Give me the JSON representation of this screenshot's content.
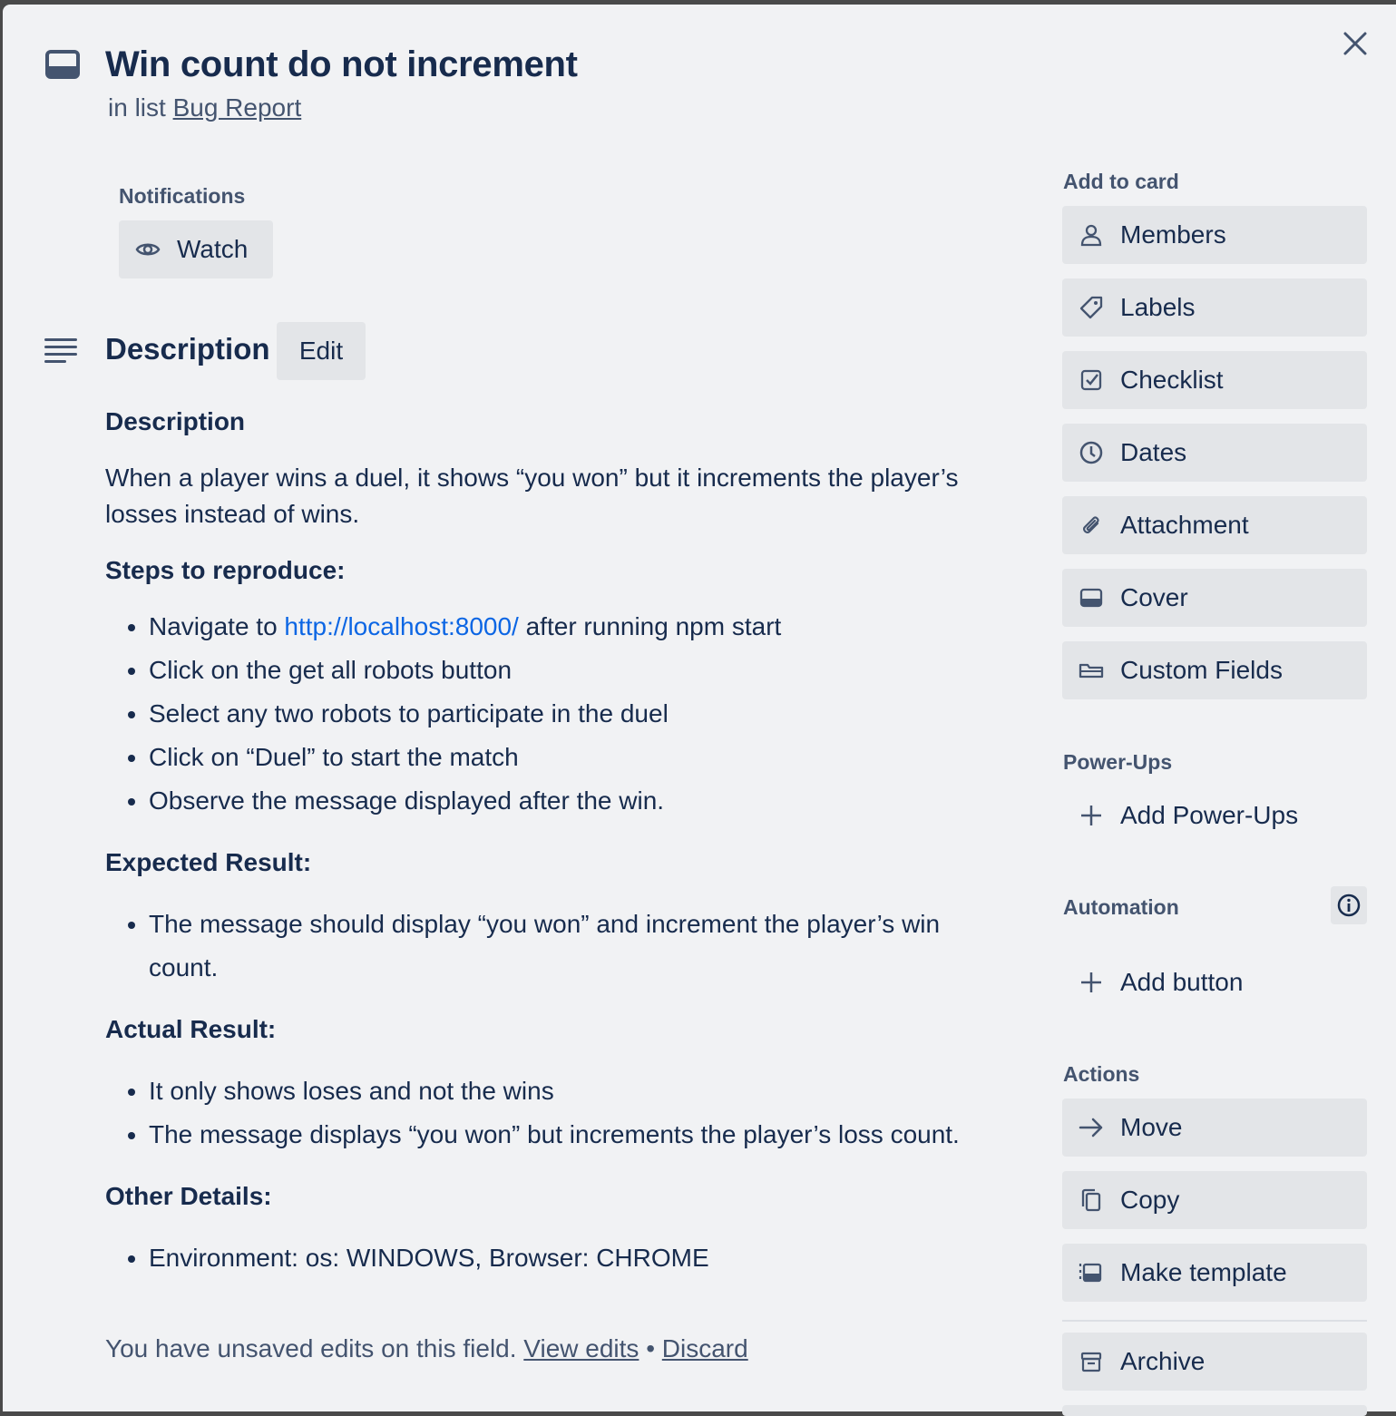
{
  "card": {
    "title": "Win count do not increment",
    "list_prefix": "in list",
    "list_name": "Bug Report"
  },
  "notifications": {
    "label": "Notifications",
    "watch_label": "Watch"
  },
  "description": {
    "heading": "Description",
    "edit_label": "Edit",
    "h_description": "Description",
    "intro": "When a player wins a duel, it shows “you won” but it increments the player’s losses instead of wins.",
    "h_steps": "Steps to reproduce:",
    "step1_pre": "Navigate to",
    "step1_link": "http://localhost:8000/",
    "step1_post": "after running npm start",
    "step2": "Click on the get all robots button",
    "step3": "Select any two robots to participate in the duel",
    "step4": "Click on “Duel” to start the match",
    "step5": "Observe the message displayed after the win.",
    "h_expected": "Expected Result:",
    "expected1": "The message should display “you won” and increment the player’s win count.",
    "h_actual": "Actual Result:",
    "actual1": "It only shows loses and not the wins",
    "actual2": "The message displays “you won” but increments the player’s loss count.",
    "h_other": "Other Details:",
    "other1": "Environment: os: WINDOWS, Browser: CHROME",
    "unsaved_text": "You have unsaved edits on this field.",
    "view_edits": "View edits",
    "separator": "•",
    "discard": "Discard"
  },
  "sidebar": {
    "add_to_card_label": "Add to card",
    "members": "Members",
    "labels": "Labels",
    "checklist": "Checklist",
    "dates": "Dates",
    "attachment": "Attachment",
    "cover": "Cover",
    "custom_fields": "Custom Fields",
    "powerups_label": "Power-Ups",
    "add_powerups": "Add Power-Ups",
    "automation_label": "Automation",
    "add_button": "Add button",
    "actions_label": "Actions",
    "move": "Move",
    "copy": "Copy",
    "make_template": "Make template",
    "archive": "Archive"
  }
}
